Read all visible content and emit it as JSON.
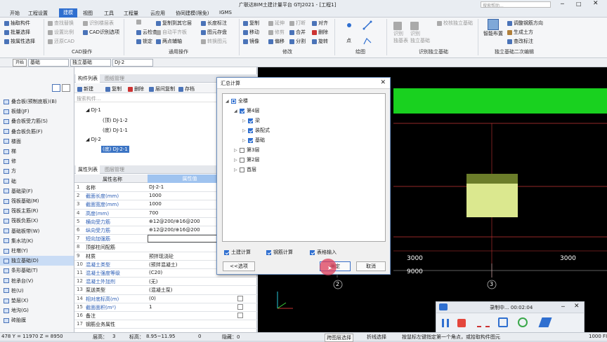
{
  "title": "广联达BIM土建计量平台 GTJ2021 - [工程1]",
  "search_placeholder": "搜索帮助...",
  "menu": [
    "开始",
    "工程设置",
    "建模",
    "视图",
    "工具",
    "工程量",
    "云应用",
    "协同建模(限免)",
    "IGMS"
  ],
  "active_menu": "建模",
  "ribbon": {
    "g1": [
      "抽取构件",
      "批量选择",
      "按属性选择"
    ],
    "g2": [
      "查找替换",
      "设置比例",
      "还原CAD"
    ],
    "g3": [
      "识别楼层表",
      "CAD识别选项"
    ],
    "g4": [
      "复制到其它层",
      "自动平齐板",
      "图元存盘",
      "长度标注",
      "图元存盘",
      "转换图元"
    ],
    "g5": [
      "云检查",
      "锁定",
      "两点辅轴"
    ],
    "g6": [
      "复制",
      "延伸",
      "打断",
      "对齐",
      "移动",
      "修剪",
      "合并",
      "删除",
      "镜像",
      "偏移",
      "分割",
      "旋转"
    ],
    "draw": [
      "点",
      "",
      "",
      ""
    ],
    "g7": [
      "识别独立基础",
      "校核独立基础"
    ],
    "g8": [
      "智能布置",
      "调整钢筋方向",
      "生成土方",
      "查改标注"
    ],
    "groups": [
      "CAD操作",
      "通用操作",
      "修改",
      "绘图",
      "识别独立基础",
      "独立基础二次编辑"
    ]
  },
  "selbar": {
    "floor": "基础",
    "type": "独立基础",
    "name": "DJ-2"
  },
  "tooltip": "开始",
  "leftnav": [
    {
      "label": "叠合板(预制底板)(B)"
    },
    {
      "label": "板缝(JF)"
    },
    {
      "label": "叠合板受力筋(S)"
    },
    {
      "label": "叠合板负筋(F)"
    },
    {
      "label": "楼面"
    },
    {
      "label": "梯"
    },
    {
      "label": "修"
    },
    {
      "label": "方"
    },
    {
      "label": "础"
    },
    {
      "label": "基础梁(F)"
    },
    {
      "label": "筏板基础(M)"
    },
    {
      "label": "筏板主筋(R)"
    },
    {
      "label": "筏板负筋(X)"
    },
    {
      "label": "基础板带(W)"
    },
    {
      "label": "集水坑(K)"
    },
    {
      "label": "柱墩(Y)"
    },
    {
      "label": "独立基础(D)",
      "active": true
    },
    {
      "label": "条形基础(T)"
    },
    {
      "label": "桩承台(V)"
    },
    {
      "label": "桩(U)"
    },
    {
      "label": "垫层(X)"
    },
    {
      "label": "地沟(G)"
    },
    {
      "label": "砖胎膜"
    }
  ],
  "comp_tabs": {
    "a": "构件列表",
    "b": "图纸管理"
  },
  "comp_tools": [
    "新建",
    "复制",
    "删除",
    "层间复制",
    "存档"
  ],
  "comp_search": "搜索构件...",
  "tree": {
    "dj1": "DJ-1",
    "dj1a": "(顶) DJ-1-2",
    "dj1b": "(底) DJ-1-1",
    "dj2": "DJ-2",
    "dj2a": "(底) DJ-2-1"
  },
  "prop_tabs": {
    "a": "属性列表",
    "b": "图层管理"
  },
  "prop_header": {
    "name": "属性名称",
    "value": "属性值"
  },
  "props": [
    {
      "n": "1",
      "name": "名称",
      "value": "DJ-2-1"
    },
    {
      "n": "2",
      "name": "截面长度(mm)",
      "value": "1000"
    },
    {
      "n": "3",
      "name": "截面宽度(mm)",
      "value": "1000"
    },
    {
      "n": "4",
      "name": "高度(mm)",
      "value": "700"
    },
    {
      "n": "5",
      "name": "横向受力筋",
      "value": "⊕12@200/⊕16@200"
    },
    {
      "n": "6",
      "name": "纵向受力筋",
      "value": "⊕12@200/⊕16@200"
    },
    {
      "n": "7",
      "name": "短向加强筋",
      "value": ""
    },
    {
      "n": "8",
      "name": "顶部柱间配筋",
      "value": ""
    },
    {
      "n": "9",
      "name": "材质",
      "value": "预拌现浇砼"
    },
    {
      "n": "10",
      "name": "混凝土类型",
      "value": "(预拌混凝土)"
    },
    {
      "n": "11",
      "name": "混凝土强度等级",
      "value": "(C20)"
    },
    {
      "n": "12",
      "name": "混凝土外加剂",
      "value": "(无)"
    },
    {
      "n": "13",
      "name": "泵送类型",
      "value": "(混凝土泵)"
    },
    {
      "n": "14",
      "name": "相对底标高(m)",
      "value": "(0)"
    },
    {
      "n": "15",
      "name": "截面面积(m²)",
      "value": "1"
    },
    {
      "n": "16",
      "name": "备注",
      "value": ""
    },
    {
      "n": "17",
      "name": "钢筋业务属性",
      "value": ""
    }
  ],
  "dialog": {
    "title": "汇总计算",
    "all": "全楼",
    "f4": "第4层",
    "beam": "梁",
    "assembly": "装配式",
    "found": "基础",
    "f3": "第3层",
    "f2": "第2层",
    "f1": "首层",
    "opt1": "土建计算",
    "opt2": "钢筋计算",
    "opt3": "表格输入",
    "select_btn": "<<选项",
    "ok_btn": "确定",
    "cancel_btn": "取消"
  },
  "cad": {
    "d1": "3000",
    "d2": "3000",
    "d3": "9000",
    "axis2": "2",
    "axis3": "3"
  },
  "recorder": {
    "title": "录制中... 00:02:04"
  },
  "status": {
    "coord": "478 Y = 11970 Z = 8950",
    "floor_h": "层高：",
    "floor_v": "3",
    "elev": "标高：",
    "elev_v": "8.95~11.95",
    "zero": "0",
    "hidden": "隐藏：0",
    "cross": "跨图层选择",
    "fold": "折线选择",
    "hint": "按鼠标左键指定第一个角点，或拾取构件图元",
    "scale": "1000 FI"
  }
}
